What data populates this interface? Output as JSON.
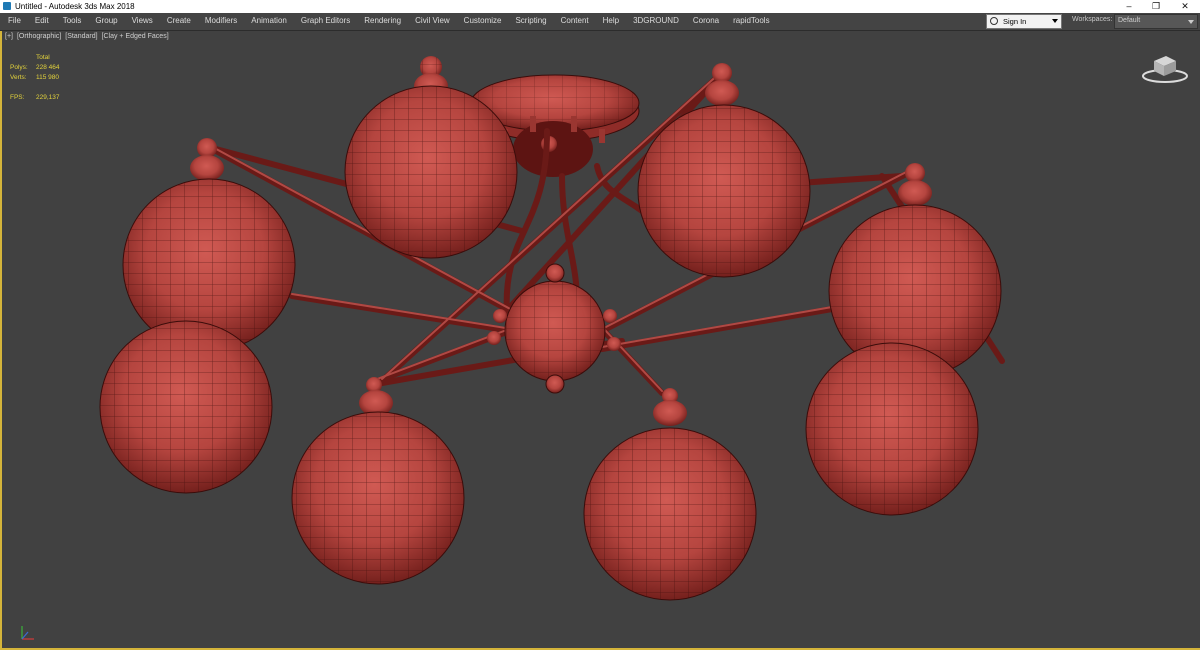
{
  "window": {
    "title": "Untitled - Autodesk 3ds Max 2018",
    "minimize": "–",
    "maximize": "❐",
    "close": "✕"
  },
  "menu": [
    "File",
    "Edit",
    "Tools",
    "Group",
    "Views",
    "Create",
    "Modifiers",
    "Animation",
    "Graph Editors",
    "Rendering",
    "Civil View",
    "Customize",
    "Scripting",
    "Content",
    "Help",
    "3DGROUND",
    "Corona",
    "rapidTools"
  ],
  "account": {
    "signin": "Sign In"
  },
  "workspaces": {
    "label": "Workspaces:",
    "value": "Default"
  },
  "viewport": {
    "labels": [
      "[+]",
      "[Orthographic]",
      "[Standard]",
      "[Clay + Edged Faces]"
    ],
    "stats": {
      "header": "Total",
      "polys_label": "Polys:",
      "polys_value": "228 464",
      "verts_label": "Verts:",
      "verts_value": "115 980",
      "fps_label": "FPS:",
      "fps_value": "229,137"
    }
  },
  "colors": {
    "clay": "#b5453f",
    "clay_dark": "#6a1a17",
    "selection_border": "#d4b43a",
    "stats_text": "#e3d33c",
    "viewport_bg": "#414141"
  },
  "icons": [
    "app-icon",
    "user-icon",
    "dropdown-arrow-icon",
    "viewcube-icon",
    "axis-tripod-icon"
  ]
}
